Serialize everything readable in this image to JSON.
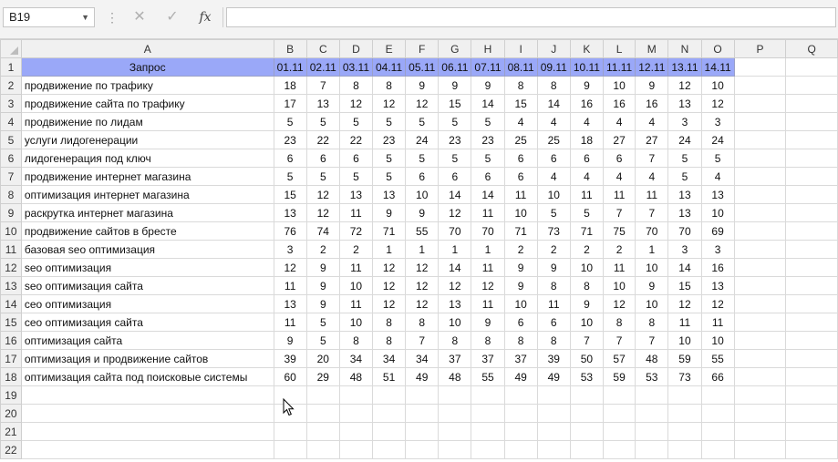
{
  "formula_bar": {
    "name_box": "B19",
    "formula": "",
    "fx_label": "fx"
  },
  "columns": [
    "A",
    "B",
    "C",
    "D",
    "E",
    "F",
    "G",
    "H",
    "I",
    "J",
    "K",
    "L",
    "M",
    "N",
    "O",
    "P",
    "Q"
  ],
  "header_row": {
    "query_label": "Запрос",
    "dates": [
      "01.11",
      "02.11",
      "03.11",
      "04.11",
      "05.11",
      "06.11",
      "07.11",
      "08.11",
      "09.11",
      "10.11",
      "11.11",
      "12.11",
      "13.11",
      "14.11"
    ]
  },
  "rows": [
    {
      "query": "продвижение по трафику",
      "values": [
        18,
        7,
        8,
        8,
        9,
        9,
        9,
        8,
        8,
        9,
        10,
        9,
        12,
        10
      ]
    },
    {
      "query": "продвижение сайта по трафику",
      "values": [
        17,
        13,
        12,
        12,
        12,
        15,
        14,
        15,
        14,
        16,
        16,
        16,
        13,
        12
      ]
    },
    {
      "query": "продвижение по лидам",
      "values": [
        5,
        5,
        5,
        5,
        5,
        5,
        5,
        4,
        4,
        4,
        4,
        4,
        3,
        3
      ]
    },
    {
      "query": "услуги лидогенерации",
      "values": [
        23,
        22,
        22,
        23,
        24,
        23,
        23,
        25,
        25,
        18,
        27,
        27,
        24,
        24
      ]
    },
    {
      "query": "лидогенерация под ключ",
      "values": [
        6,
        6,
        6,
        5,
        5,
        5,
        5,
        6,
        6,
        6,
        6,
        7,
        5,
        5
      ]
    },
    {
      "query": "продвижение интернет магазина",
      "values": [
        5,
        5,
        5,
        5,
        6,
        6,
        6,
        6,
        4,
        4,
        4,
        4,
        5,
        4
      ]
    },
    {
      "query": "оптимизация интернет магазина",
      "values": [
        15,
        12,
        13,
        13,
        10,
        14,
        14,
        11,
        10,
        11,
        11,
        11,
        13,
        13
      ]
    },
    {
      "query": "раскрутка интернет магазина",
      "values": [
        13,
        12,
        11,
        9,
        9,
        12,
        11,
        10,
        5,
        5,
        7,
        7,
        13,
        10
      ]
    },
    {
      "query": "продвижение сайтов в бресте",
      "values": [
        76,
        74,
        72,
        71,
        55,
        70,
        70,
        71,
        73,
        71,
        75,
        70,
        70,
        69
      ]
    },
    {
      "query": "базовая seo оптимизация",
      "values": [
        3,
        2,
        2,
        1,
        1,
        1,
        1,
        2,
        2,
        2,
        2,
        1,
        3,
        3
      ]
    },
    {
      "query": "seo оптимизация",
      "values": [
        12,
        9,
        11,
        12,
        12,
        14,
        11,
        9,
        9,
        10,
        11,
        10,
        14,
        16
      ]
    },
    {
      "query": "seo оптимизация сайта",
      "values": [
        11,
        9,
        10,
        12,
        12,
        12,
        12,
        9,
        8,
        8,
        10,
        9,
        15,
        13
      ]
    },
    {
      "query": "сео оптимизация",
      "values": [
        13,
        9,
        11,
        12,
        12,
        13,
        11,
        10,
        11,
        9,
        12,
        10,
        12,
        12
      ]
    },
    {
      "query": "сео оптимизация сайта",
      "values": [
        11,
        5,
        10,
        8,
        8,
        10,
        9,
        6,
        6,
        10,
        8,
        8,
        11,
        11
      ]
    },
    {
      "query": "оптимизация сайта",
      "values": [
        9,
        5,
        8,
        8,
        7,
        8,
        8,
        8,
        8,
        7,
        7,
        7,
        10,
        10
      ]
    },
    {
      "query": "оптимизация и продвижение сайтов",
      "values": [
        39,
        20,
        34,
        34,
        34,
        37,
        37,
        37,
        39,
        50,
        57,
        48,
        59,
        55
      ]
    },
    {
      "query": "оптимизация сайта под поисковые системы",
      "values": [
        60,
        29,
        48,
        51,
        49,
        48,
        55,
        49,
        49,
        53,
        59,
        53,
        73,
        66
      ]
    }
  ],
  "empty_row_numbers": [
    "19",
    "20",
    "21",
    "22"
  ],
  "colors": {
    "header_fill": "#9aa8f8"
  }
}
